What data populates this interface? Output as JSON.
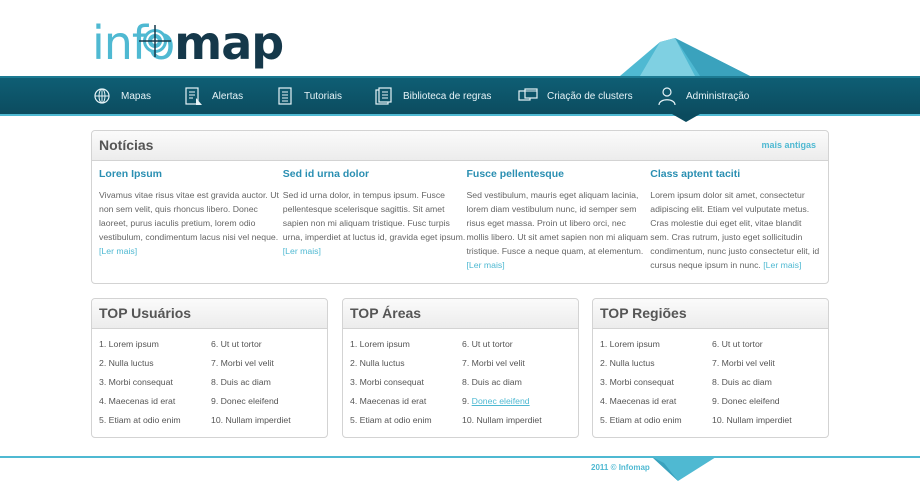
{
  "brand": {
    "logo_part1": "info",
    "logo_part2": "map",
    "accent_color": "#4fb9d2",
    "dark_color": "#0b4b5e"
  },
  "nav": {
    "items": [
      {
        "label": "Mapas",
        "icon": "globe-icon"
      },
      {
        "label": "Alertas",
        "icon": "alert-document-icon"
      },
      {
        "label": "Tutoriais",
        "icon": "document-list-icon"
      },
      {
        "label": "Biblioteca de regras",
        "icon": "book-icon"
      },
      {
        "label": "Criação de clusters",
        "icon": "windows-icon"
      },
      {
        "label": "Administração",
        "icon": "user-icon"
      }
    ]
  },
  "news": {
    "title": "Notícias",
    "more_link": "mais antigas",
    "read_more": "[Ler mais]",
    "items": [
      {
        "title": "Loren Ipsum",
        "body": "Vivamus vitae risus vitae est gravida auctor. Ut non sem velit, quis rhoncus libero. Donec laoreet, purus iaculis pretium, lorem odio vestibulum, condimentum lacus nisi vel neque."
      },
      {
        "title": "Sed id urna dolor",
        "body": "Sed id urna dolor, in tempus ipsum. Fusce pellentesque scelerisque sagittis. Sit amet sapien non mi aliquam tristique. Fusc turpis urna, imperdiet at luctus id, gravida eget ipsum."
      },
      {
        "title": "Fusce pellentesque",
        "body": "Sed vestibulum, mauris eget aliquam lacinia, lorem diam vestibulum nunc, id semper sem risus eget massa. Proin ut libero orci, nec mollis libero. Ut sit amet sapien non mi aliquam tristique. Fusce a neque quam, at elementum."
      },
      {
        "title": "Class aptent taciti",
        "body": "Lorem ipsum dolor sit amet, consectetur adipiscing elit. Etiam vel vulputate metus. Cras molestie dui eget elit, vitae blandit sem. Cras rutrum, justo eget sollicitudin condimentum, nunc justo consectetur elit, id cursus neque ipsum in nunc."
      }
    ]
  },
  "top_panels": [
    {
      "title": "TOP Usuários",
      "col1": [
        "1. Lorem ipsum",
        "2. Nulla luctus",
        "3. Morbi consequat",
        "4. Maecenas id erat",
        "5. Etiam at odio enim"
      ],
      "col2": [
        "6. Ut ut tortor",
        "7. Morbi vel velit",
        "8. Duis ac diam",
        "9. Donec eleifend",
        "10. Nullam imperdiet"
      ]
    },
    {
      "title": "TOP Áreas",
      "col1": [
        "1. Lorem ipsum",
        "2. Nulla luctus",
        "3. Morbi consequat",
        "4. Maecenas id erat",
        "5. Etiam at odio enim"
      ],
      "col2": [
        "6. Ut ut tortor",
        "7. Morbi vel velit",
        "8. Duis ac diam",
        "9. ",
        "10. Nullam imperdiet"
      ],
      "col2_link": "Donec eleifend"
    },
    {
      "title": "TOP Regiões",
      "col1": [
        "1. Lorem ipsum",
        "2. Nulla luctus",
        "3. Morbi consequat",
        "4. Maecenas id erat",
        "5. Etiam at odio enim"
      ],
      "col2": [
        "6. Ut ut tortor",
        "7. Morbi vel velit",
        "8. Duis ac diam",
        "9. Donec eleifend",
        "10. Nullam imperdiet"
      ]
    }
  ],
  "footer": {
    "text": "2011 © Infomap"
  }
}
